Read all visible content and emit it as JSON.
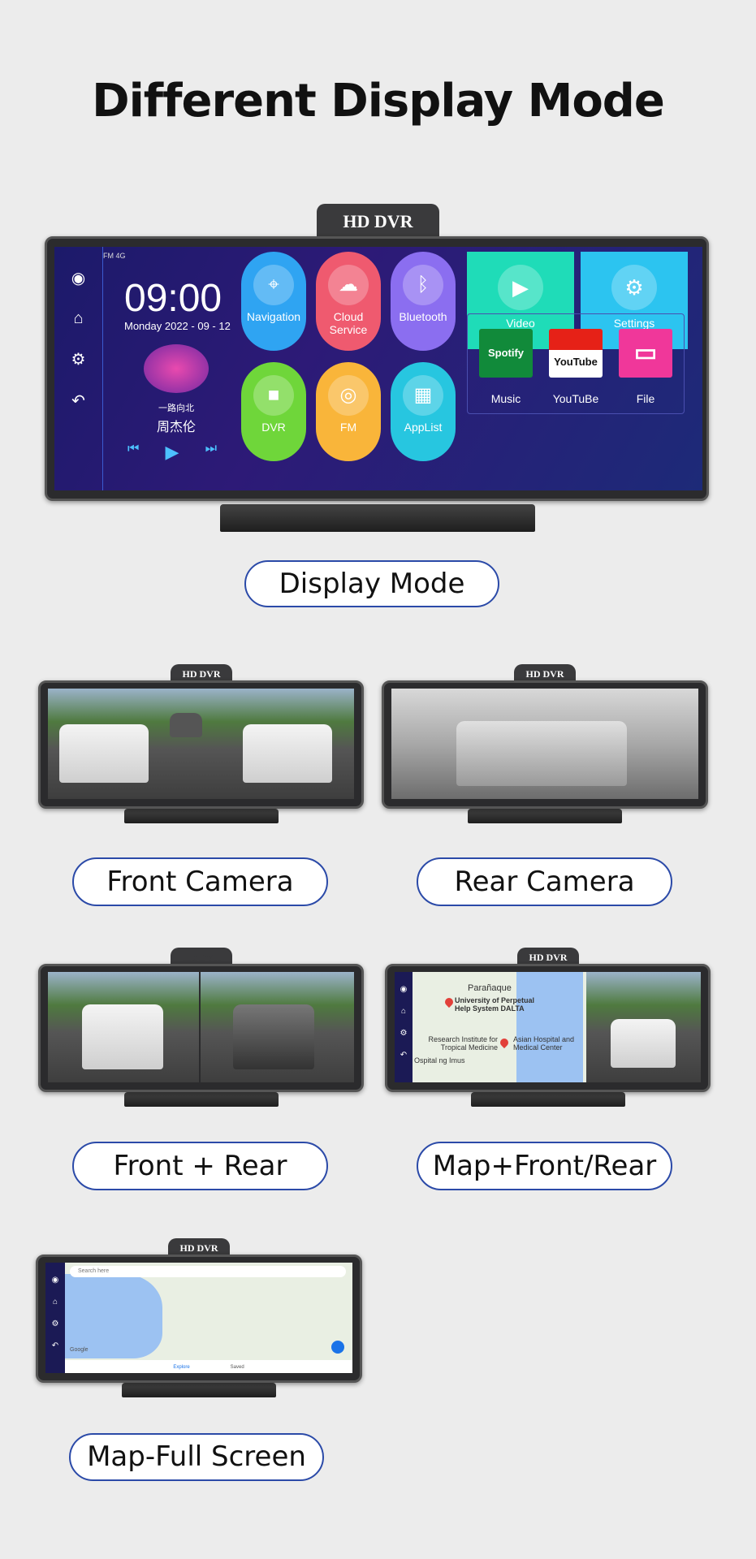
{
  "title": "Different Display Mode",
  "badge": "HD DVR",
  "main": {
    "status": "FM 4G",
    "time": "09:00",
    "date": "Monday  2022 - 09 - 12",
    "song": "一路向北",
    "artist": "周杰伦",
    "apps": [
      {
        "label": "Navigation",
        "color": "#2fa4f2"
      },
      {
        "label": "Cloud Service",
        "color": "#ef5a6f"
      },
      {
        "label": "Bluetooth",
        "color": "#8b6ef0"
      },
      {
        "label": "DVR",
        "color": "#6fd63a"
      },
      {
        "label": "FM",
        "color": "#f9b53a"
      },
      {
        "label": "AppList",
        "color": "#27c6e0"
      }
    ],
    "tiles": [
      {
        "label": "Video",
        "color": "#1fdcb8"
      },
      {
        "label": "Settings",
        "color": "#2cc4f0"
      }
    ],
    "media": [
      {
        "label": "Music",
        "icon_text": "Spotify"
      },
      {
        "label": "YouTuBe",
        "icon_text": "YouTube"
      },
      {
        "label": "File"
      }
    ],
    "sidebar_icons": [
      "camera-icon",
      "home-icon",
      "gear-icon",
      "back-icon"
    ]
  },
  "modes": [
    {
      "label": "Display Mode"
    },
    {
      "label": "Front Camera"
    },
    {
      "label": "Rear Camera"
    },
    {
      "label": "Front + Rear"
    },
    {
      "label": "Map+Front/Rear"
    },
    {
      "label": "Map-Full Screen"
    }
  ],
  "map_labels": {
    "city": "Parañaque",
    "poi1": "University of Perpetual Help System DALTA",
    "poi2": "Research Institute for Tropical Medicine",
    "poi3": "Asian Hospital and Medical Center",
    "poi4": "Ospital ng Imus"
  },
  "fullmap": {
    "search_placeholder": "Search here",
    "tab1": "Explore",
    "tab2": "Saved",
    "logo": "Google"
  }
}
